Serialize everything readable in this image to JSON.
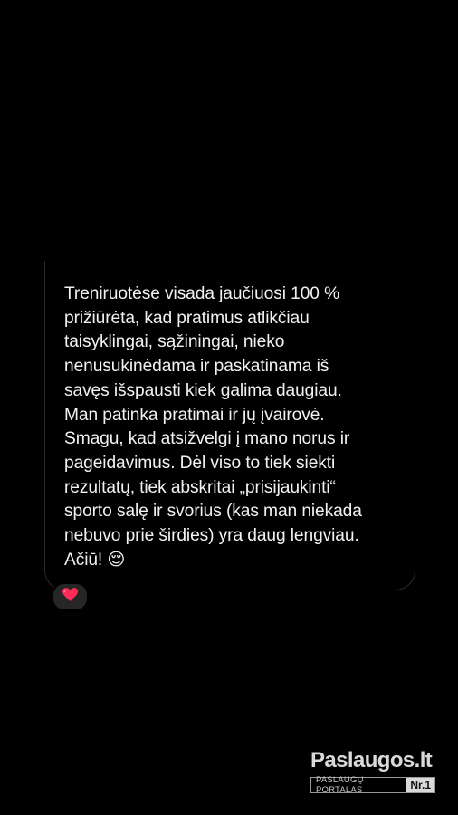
{
  "message": {
    "text": "Treniruotėse visada jaučiuosi 100 %\nprižiūrėta, kad pratimus atlikčiau\ntaisyklingai, sąžiningai, nieko\nnenusukinėdama ir paskatinama iš\nsavęs išspausti kiek galima daugiau.\nMan patinka pratimai ir jų įvairovė.\nSmagu, kad atsižvelgi į mano norus ir\npageidavimus. Dėl viso to tiek siekti\nrezultatų, tiek abskritai „prisijaukinti“\nsporto salę ir svorius (kas man niekada\nnebuvo prie širdies) yra daug lengviau.\nAčiū! 😌",
    "reaction": "heart-icon"
  },
  "watermark": {
    "brand": "Paslaugos.lt",
    "subtitle": "PASLAUGŲ PORTALAS",
    "badge": "Nr.1"
  },
  "colors": {
    "background": "#000000",
    "text": "#f2f2f2",
    "bubble_border": "#2a2a2a",
    "reaction_bg": "#262626",
    "heart": "#ff2d55"
  }
}
